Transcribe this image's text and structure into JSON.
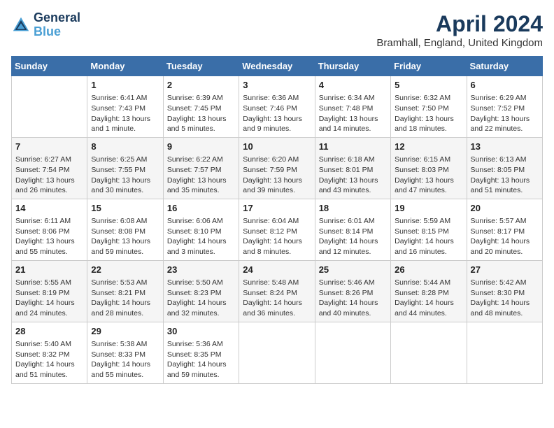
{
  "header": {
    "logo_line1": "General",
    "logo_line2": "Blue",
    "month": "April 2024",
    "location": "Bramhall, England, United Kingdom"
  },
  "days_of_week": [
    "Sunday",
    "Monday",
    "Tuesday",
    "Wednesday",
    "Thursday",
    "Friday",
    "Saturday"
  ],
  "weeks": [
    [
      {
        "day": "",
        "content": ""
      },
      {
        "day": "1",
        "content": "Sunrise: 6:41 AM\nSunset: 7:43 PM\nDaylight: 13 hours\nand 1 minute."
      },
      {
        "day": "2",
        "content": "Sunrise: 6:39 AM\nSunset: 7:45 PM\nDaylight: 13 hours\nand 5 minutes."
      },
      {
        "day": "3",
        "content": "Sunrise: 6:36 AM\nSunset: 7:46 PM\nDaylight: 13 hours\nand 9 minutes."
      },
      {
        "day": "4",
        "content": "Sunrise: 6:34 AM\nSunset: 7:48 PM\nDaylight: 13 hours\nand 14 minutes."
      },
      {
        "day": "5",
        "content": "Sunrise: 6:32 AM\nSunset: 7:50 PM\nDaylight: 13 hours\nand 18 minutes."
      },
      {
        "day": "6",
        "content": "Sunrise: 6:29 AM\nSunset: 7:52 PM\nDaylight: 13 hours\nand 22 minutes."
      }
    ],
    [
      {
        "day": "7",
        "content": "Sunrise: 6:27 AM\nSunset: 7:54 PM\nDaylight: 13 hours\nand 26 minutes."
      },
      {
        "day": "8",
        "content": "Sunrise: 6:25 AM\nSunset: 7:55 PM\nDaylight: 13 hours\nand 30 minutes."
      },
      {
        "day": "9",
        "content": "Sunrise: 6:22 AM\nSunset: 7:57 PM\nDaylight: 13 hours\nand 35 minutes."
      },
      {
        "day": "10",
        "content": "Sunrise: 6:20 AM\nSunset: 7:59 PM\nDaylight: 13 hours\nand 39 minutes."
      },
      {
        "day": "11",
        "content": "Sunrise: 6:18 AM\nSunset: 8:01 PM\nDaylight: 13 hours\nand 43 minutes."
      },
      {
        "day": "12",
        "content": "Sunrise: 6:15 AM\nSunset: 8:03 PM\nDaylight: 13 hours\nand 47 minutes."
      },
      {
        "day": "13",
        "content": "Sunrise: 6:13 AM\nSunset: 8:05 PM\nDaylight: 13 hours\nand 51 minutes."
      }
    ],
    [
      {
        "day": "14",
        "content": "Sunrise: 6:11 AM\nSunset: 8:06 PM\nDaylight: 13 hours\nand 55 minutes."
      },
      {
        "day": "15",
        "content": "Sunrise: 6:08 AM\nSunset: 8:08 PM\nDaylight: 13 hours\nand 59 minutes."
      },
      {
        "day": "16",
        "content": "Sunrise: 6:06 AM\nSunset: 8:10 PM\nDaylight: 14 hours\nand 3 minutes."
      },
      {
        "day": "17",
        "content": "Sunrise: 6:04 AM\nSunset: 8:12 PM\nDaylight: 14 hours\nand 8 minutes."
      },
      {
        "day": "18",
        "content": "Sunrise: 6:01 AM\nSunset: 8:14 PM\nDaylight: 14 hours\nand 12 minutes."
      },
      {
        "day": "19",
        "content": "Sunrise: 5:59 AM\nSunset: 8:15 PM\nDaylight: 14 hours\nand 16 minutes."
      },
      {
        "day": "20",
        "content": "Sunrise: 5:57 AM\nSunset: 8:17 PM\nDaylight: 14 hours\nand 20 minutes."
      }
    ],
    [
      {
        "day": "21",
        "content": "Sunrise: 5:55 AM\nSunset: 8:19 PM\nDaylight: 14 hours\nand 24 minutes."
      },
      {
        "day": "22",
        "content": "Sunrise: 5:53 AM\nSunset: 8:21 PM\nDaylight: 14 hours\nand 28 minutes."
      },
      {
        "day": "23",
        "content": "Sunrise: 5:50 AM\nSunset: 8:23 PM\nDaylight: 14 hours\nand 32 minutes."
      },
      {
        "day": "24",
        "content": "Sunrise: 5:48 AM\nSunset: 8:24 PM\nDaylight: 14 hours\nand 36 minutes."
      },
      {
        "day": "25",
        "content": "Sunrise: 5:46 AM\nSunset: 8:26 PM\nDaylight: 14 hours\nand 40 minutes."
      },
      {
        "day": "26",
        "content": "Sunrise: 5:44 AM\nSunset: 8:28 PM\nDaylight: 14 hours\nand 44 minutes."
      },
      {
        "day": "27",
        "content": "Sunrise: 5:42 AM\nSunset: 8:30 PM\nDaylight: 14 hours\nand 48 minutes."
      }
    ],
    [
      {
        "day": "28",
        "content": "Sunrise: 5:40 AM\nSunset: 8:32 PM\nDaylight: 14 hours\nand 51 minutes."
      },
      {
        "day": "29",
        "content": "Sunrise: 5:38 AM\nSunset: 8:33 PM\nDaylight: 14 hours\nand 55 minutes."
      },
      {
        "day": "30",
        "content": "Sunrise: 5:36 AM\nSunset: 8:35 PM\nDaylight: 14 hours\nand 59 minutes."
      },
      {
        "day": "",
        "content": ""
      },
      {
        "day": "",
        "content": ""
      },
      {
        "day": "",
        "content": ""
      },
      {
        "day": "",
        "content": ""
      }
    ]
  ]
}
